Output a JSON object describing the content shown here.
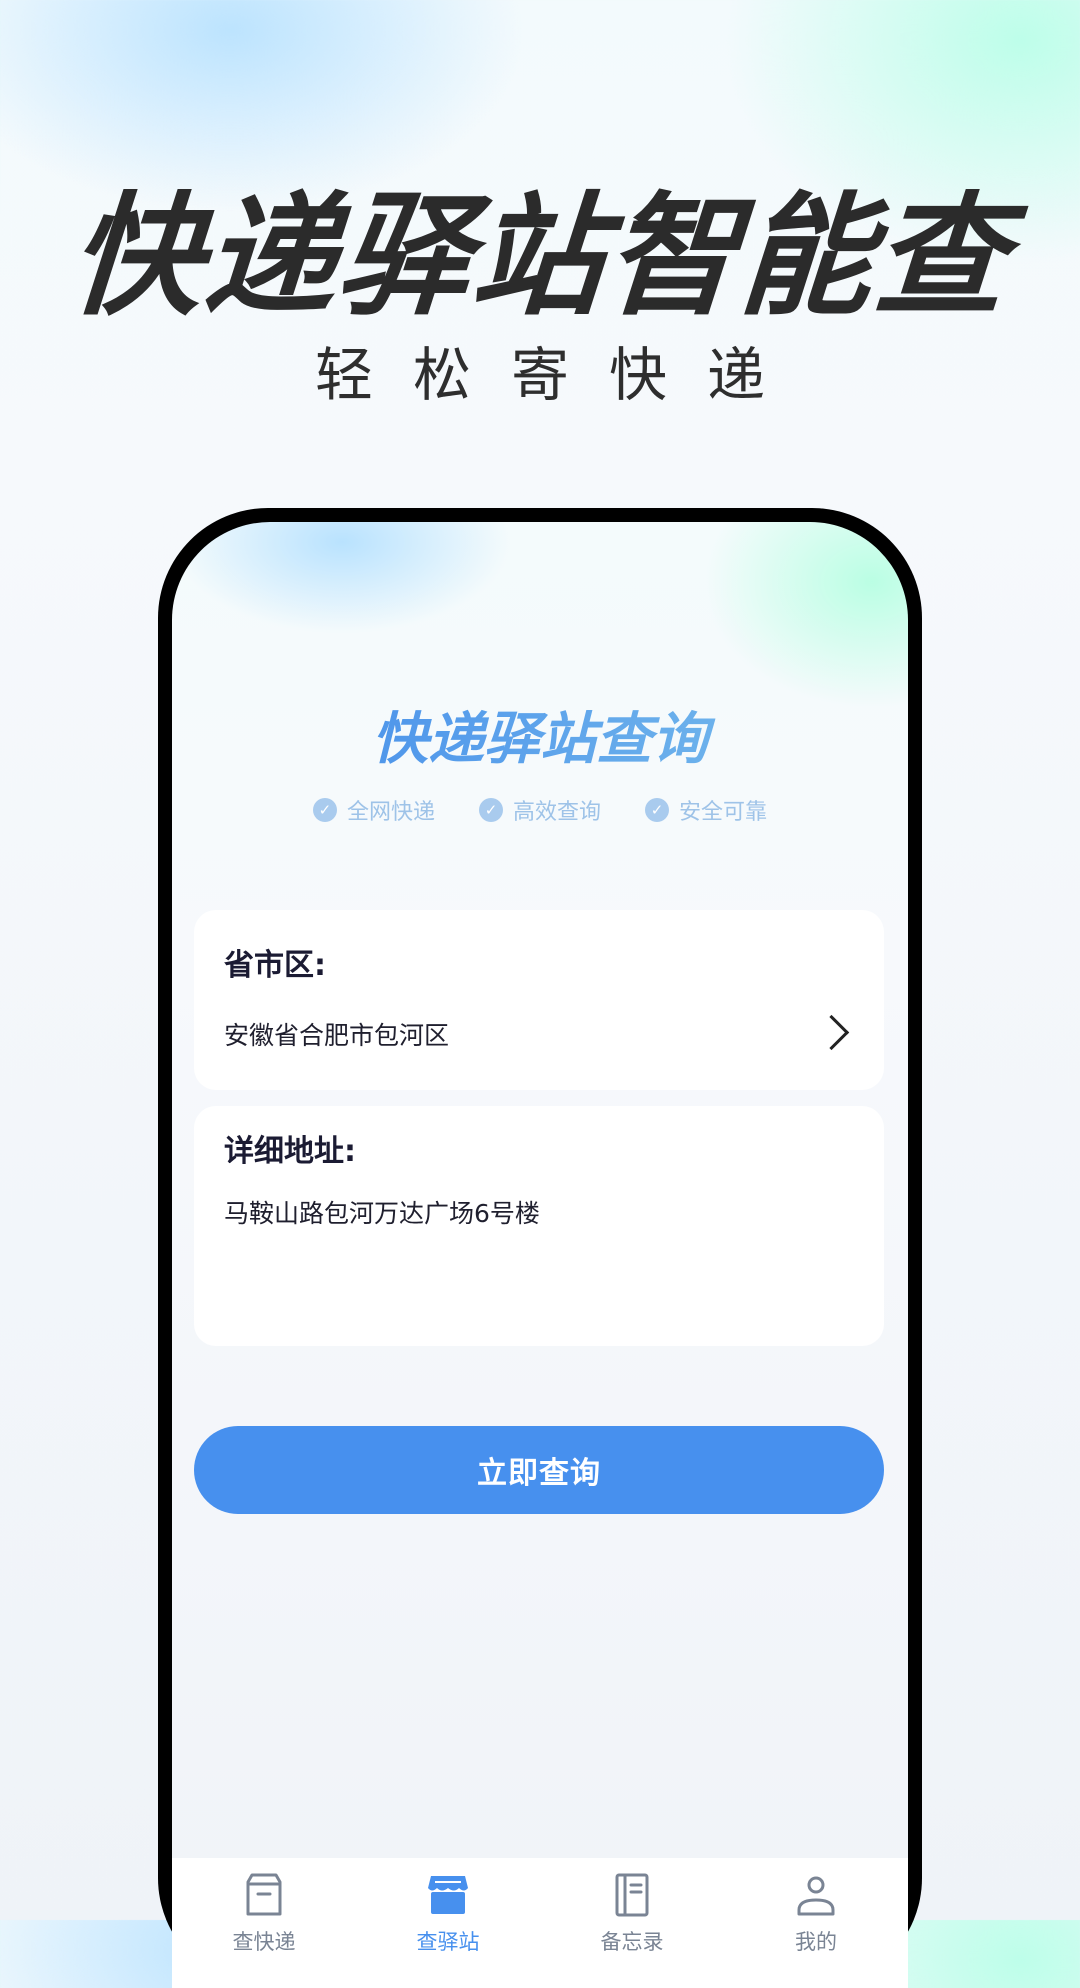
{
  "headline": "快递驿站智能查",
  "subline": "轻松寄快递",
  "app": {
    "title": "快递驿站查询",
    "features": [
      "全网快递",
      "高效查询",
      "安全可靠"
    ],
    "region": {
      "label": "省市区:",
      "value": "安徽省合肥市包河区"
    },
    "address": {
      "label": "详细地址:",
      "value": "马鞍山路包河万达广场6号楼"
    },
    "query_button": "立即查询",
    "tabs": [
      {
        "label": "查快递",
        "icon": "package-icon",
        "active": false
      },
      {
        "label": "查驿站",
        "icon": "store-icon",
        "active": true
      },
      {
        "label": "备忘录",
        "icon": "notebook-icon",
        "active": false
      },
      {
        "label": "我的",
        "icon": "user-icon",
        "active": false
      }
    ]
  },
  "colors": {
    "accent": "#4790ee",
    "headline": "#2b2b2b",
    "feature": "#9ec3e8",
    "tab_inactive": "#7a8494"
  }
}
